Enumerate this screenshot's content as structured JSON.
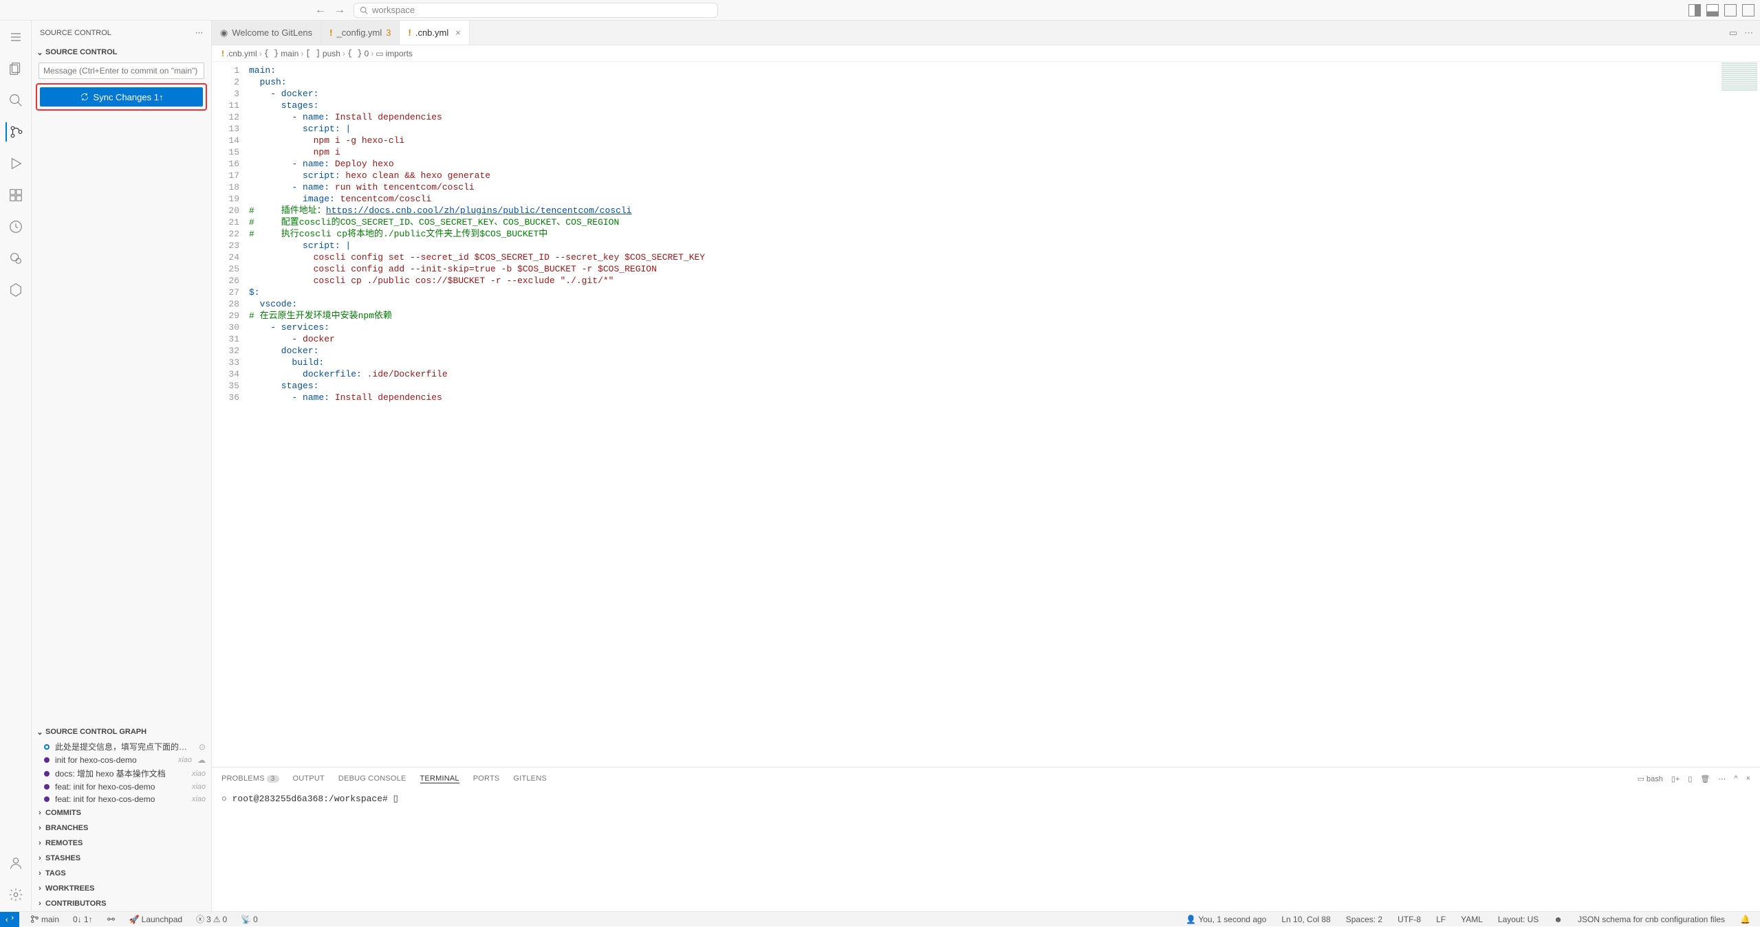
{
  "titlebar": {
    "search_placeholder": "workspace"
  },
  "sidebar": {
    "header": "SOURCE CONTROL",
    "section_scm": "SOURCE CONTROL",
    "commit_placeholder": "Message (Ctrl+Enter to commit on \"main\")",
    "sync_label": "Sync Changes 1↑",
    "section_graph": "SOURCE CONTROL GRAPH",
    "graph_items": [
      {
        "msg": "此处是提交信息，填写完点下面的按钮...",
        "author": ""
      },
      {
        "msg": "init for hexo-cos-demo",
        "author": "xiao"
      },
      {
        "msg": "docs: 增加 hexo 基本操作文档",
        "author": "xiao"
      },
      {
        "msg": "feat: init for hexo-cos-demo",
        "author": "xiao"
      },
      {
        "msg": "feat: init for hexo-cos-demo",
        "author": "xiao"
      }
    ],
    "sections": [
      "COMMITS",
      "BRANCHES",
      "REMOTES",
      "STASHES",
      "TAGS",
      "WORKTREES",
      "CONTRIBUTORS"
    ]
  },
  "tabs": {
    "welcome": "Welcome to GitLens",
    "config": "_config.yml",
    "config_badge": "3",
    "cnb": ".cnb.yml"
  },
  "breadcrumbs": {
    "file": ".cnb.yml",
    "p1": "main",
    "p2": "push",
    "p3": "0",
    "p4": "imports"
  },
  "code": {
    "lines": [
      {
        "n": 1,
        "t": "main:",
        "k": "key"
      },
      {
        "n": 2,
        "t": "  push:",
        "k": "key"
      },
      {
        "n": 3,
        "t": "    - docker:",
        "k": "key"
      },
      {
        "n": 11,
        "t": "      stages:",
        "k": "key"
      },
      {
        "n": 12,
        "t": "        - name: Install dependencies",
        "k": "kv"
      },
      {
        "n": 13,
        "t": "          script: |",
        "k": "key"
      },
      {
        "n": 14,
        "t": "            npm i -g hexo-cli",
        "k": "str"
      },
      {
        "n": 15,
        "t": "            npm i",
        "k": "str"
      },
      {
        "n": 16,
        "t": "        - name: Deploy hexo",
        "k": "kv"
      },
      {
        "n": 17,
        "t": "          script: hexo clean && hexo generate",
        "k": "kv"
      },
      {
        "n": 18,
        "t": "        - name: run with tencentcom/coscli",
        "k": "kv"
      },
      {
        "n": 19,
        "t": "          image: tencentcom/coscli",
        "k": "kv"
      },
      {
        "n": 20,
        "t": "#     插件地址：https://docs.cnb.cool/zh/plugins/public/tencentcom/coscli",
        "k": "cmt",
        "link": true
      },
      {
        "n": 21,
        "t": "#     配置coscli的COS_SECRET_ID、COS_SECRET_KEY、COS_BUCKET、COS_REGION",
        "k": "cmt"
      },
      {
        "n": 22,
        "t": "#     执行coscli cp将本地的./public文件夹上传到$COS_BUCKET中",
        "k": "cmt"
      },
      {
        "n": 23,
        "t": "          script: |",
        "k": "key"
      },
      {
        "n": 24,
        "t": "            coscli config set --secret_id $COS_SECRET_ID --secret_key $COS_SECRET_KEY",
        "k": "str"
      },
      {
        "n": 25,
        "t": "            coscli config add --init-skip=true -b $COS_BUCKET -r $COS_REGION",
        "k": "str"
      },
      {
        "n": 26,
        "t": "            coscli cp ./public cos://$BUCKET -r --exclude \"./.git/*\"",
        "k": "str"
      },
      {
        "n": 27,
        "t": "$:",
        "k": "key"
      },
      {
        "n": 28,
        "t": "  vscode:",
        "k": "key"
      },
      {
        "n": 29,
        "t": "# 在云原生开发环境中安装npm依赖",
        "k": "cmt"
      },
      {
        "n": 30,
        "t": "    - services:",
        "k": "key"
      },
      {
        "n": 31,
        "t": "        - docker",
        "k": "str"
      },
      {
        "n": 32,
        "t": "      docker:",
        "k": "key"
      },
      {
        "n": 33,
        "t": "        build:",
        "k": "key"
      },
      {
        "n": 34,
        "t": "          dockerfile: .ide/Dockerfile",
        "k": "kv"
      },
      {
        "n": 35,
        "t": "      stages:",
        "k": "key"
      },
      {
        "n": 36,
        "t": "        - name: Install dependencies",
        "k": "kv"
      }
    ]
  },
  "panel": {
    "tabs": {
      "problems": "PROBLEMS",
      "problems_count": "3",
      "output": "OUTPUT",
      "debug": "DEBUG CONSOLE",
      "terminal": "TERMINAL",
      "ports": "PORTS",
      "gitlens": "GITLENS"
    },
    "shell_label": "bash",
    "prompt": "○ root@283255d6a368:/workspace# ▯"
  },
  "status": {
    "branch": "main",
    "sync": "0↓ 1↑",
    "launchpad": "Launchpad",
    "errors": "3",
    "warnings": "0",
    "ports": "0",
    "blame": "You, 1 second ago",
    "pos": "Ln 10, Col 88",
    "spaces": "Spaces: 2",
    "enc": "UTF-8",
    "eol": "LF",
    "lang": "YAML",
    "layout": "Layout: US",
    "schema": "JSON schema for cnb configuration files"
  }
}
